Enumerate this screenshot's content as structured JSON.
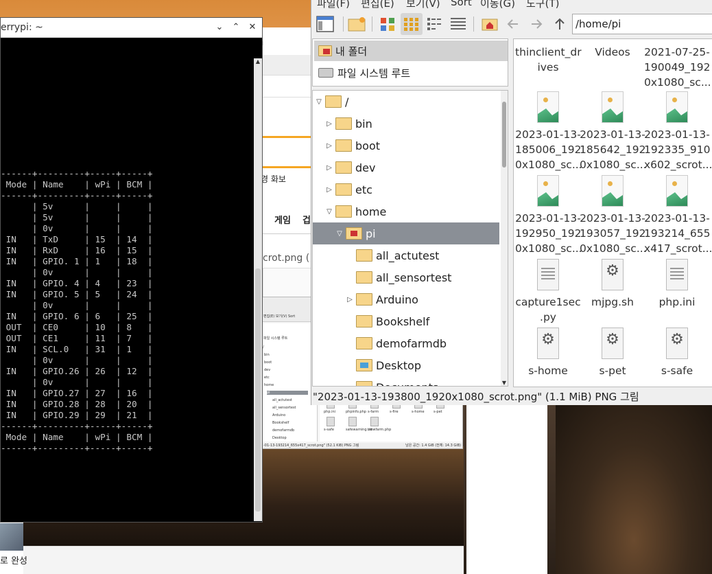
{
  "terminal": {
    "title": "errypi: ~",
    "controls": [
      "⌄",
      "⌃",
      "✕"
    ],
    "lines": [
      "------+---------+-----+-----+",
      " Mode | Name    | wPi | BCM |",
      "------+---------+-----+-----+",
      "      | 5v      |     |     |",
      "      | 5v      |     |     |",
      "      | 0v      |     |     |",
      " IN   | TxD     | 15  | 14  |",
      " IN   | RxD     | 16  | 15  |",
      " IN   | GPIO. 1 | 1   | 18  |",
      "      | 0v      |     |     |",
      " IN   | GPIO. 4 | 4   | 23  |",
      " IN   | GPIO. 5 | 5   | 24  |",
      "      | 0v      |     |     |",
      " IN   | GPIO. 6 | 6   | 25  |",
      " OUT  | CE0     | 10  | 8   |",
      " OUT  | CE1     | 11  | 7   |",
      " IN   | SCL.0   | 31  | 1   |",
      "      | 0v      |     |     |",
      " IN   | GPIO.26 | 26  | 12  |",
      "      | 0v      |     |     |",
      " IN   | GPIO.27 | 27  | 16  |",
      " IN   | GPIO.28 | 28  | 20  |",
      " IN   | GPIO.29 | 29  | 21  |",
      "------+---------+-----+-----+",
      " Mode | Name    | wPi | BCM |",
      "------+---------+-----+-----+"
    ]
  },
  "browser": {
    "text_m": "m",
    "text_korean": "경 화보",
    "tab_games": "게임",
    "tab_games2": "겁",
    "filename_fragment": "crot.png (",
    "bottom_text": "로 완성"
  },
  "mini": {
    "menu": "편집(E) 보기(V) Sort",
    "places": "파일 시스템 루트",
    "tree": [
      "/",
      "bin",
      "boot",
      "dev",
      "etc",
      "home",
      "pi",
      "all_actutest",
      "all_sensortest",
      "Arduino",
      "Bookshelf",
      "demofarmdb",
      "Desktop"
    ],
    "files_row1": [
      "php.ini",
      "phpinfo.php",
      "s-farm",
      "s-fire",
      "s-home",
      "s-pet"
    ],
    "files_row2": [
      "s-safe",
      "safewarning.txt",
      "viewfarm.php"
    ],
    "status_left": "-01-13-193214_655x417_scrot.png\" (52.1 KiB) PNG 그림",
    "status_right": "남은 공간: 1.4 GiB (전체: 14.3 GiB)"
  },
  "filemanager": {
    "menu": [
      "파일(F)",
      "편집(E)",
      "보기(V)",
      "Sort",
      "이동(G)",
      "도구(T)"
    ],
    "path": "/home/pi",
    "places": [
      "내 폴더",
      "파일 시스템 루트"
    ],
    "tree": [
      {
        "label": "/",
        "twisty": "▽",
        "indent": 0,
        "type": "folder"
      },
      {
        "label": "bin",
        "twisty": "▷",
        "indent": 1,
        "type": "folder"
      },
      {
        "label": "boot",
        "twisty": "▷",
        "indent": 1,
        "type": "folder"
      },
      {
        "label": "dev",
        "twisty": "▷",
        "indent": 1,
        "type": "folder"
      },
      {
        "label": "etc",
        "twisty": "▷",
        "indent": 1,
        "type": "folder"
      },
      {
        "label": "home",
        "twisty": "▽",
        "indent": 1,
        "type": "folder"
      },
      {
        "label": "pi",
        "twisty": "▽",
        "indent": 2,
        "type": "home",
        "selected": true
      },
      {
        "label": "all_actutest",
        "twisty": "",
        "indent": 3,
        "type": "folder"
      },
      {
        "label": "all_sensortest",
        "twisty": "",
        "indent": 3,
        "type": "folder"
      },
      {
        "label": "Arduino",
        "twisty": "▷",
        "indent": 3,
        "type": "folder"
      },
      {
        "label": "Bookshelf",
        "twisty": "",
        "indent": 3,
        "type": "folder"
      },
      {
        "label": "demofarmdb",
        "twisty": "",
        "indent": 3,
        "type": "folder"
      },
      {
        "label": "Desktop",
        "twisty": "",
        "indent": 3,
        "type": "desk"
      },
      {
        "label": "Documents",
        "twisty": "",
        "indent": 3,
        "type": "folder"
      }
    ],
    "files": [
      {
        "label": "thinclient_dr\nives",
        "icon": "none"
      },
      {
        "label": "Videos",
        "icon": "none"
      },
      {
        "label": "2021-07-25-\n190049_192\n0x1080_sc...",
        "icon": "none"
      },
      {
        "label": "2023-01-13-\n185006_192\n0x1080_sc...",
        "icon": "image"
      },
      {
        "label": "2023-01-13-\n185642_192\n0x1080_sc...",
        "icon": "image"
      },
      {
        "label": "2023-01-13-\n192335_910\nx602_scrot...",
        "icon": "image"
      },
      {
        "label": "2023-01-13-\n192950_192\n0x1080_sc...",
        "icon": "image"
      },
      {
        "label": "2023-01-13-\n193057_192\n0x1080_sc...",
        "icon": "image"
      },
      {
        "label": "2023-01-13-\n193214_655\nx417_scrot...",
        "icon": "image"
      },
      {
        "label": "capture1sec\n.py",
        "icon": "doc"
      },
      {
        "label": "mjpg.sh",
        "icon": "gear"
      },
      {
        "label": "php.ini",
        "icon": "doc"
      },
      {
        "label": "s-home",
        "icon": "gear"
      },
      {
        "label": "s-pet",
        "icon": "gear"
      },
      {
        "label": "s-safe",
        "icon": "gear"
      }
    ],
    "status": "\"2023-01-13-193800_1920x1080_scrot.png\" (1.1 MiB) PNG 그림"
  }
}
